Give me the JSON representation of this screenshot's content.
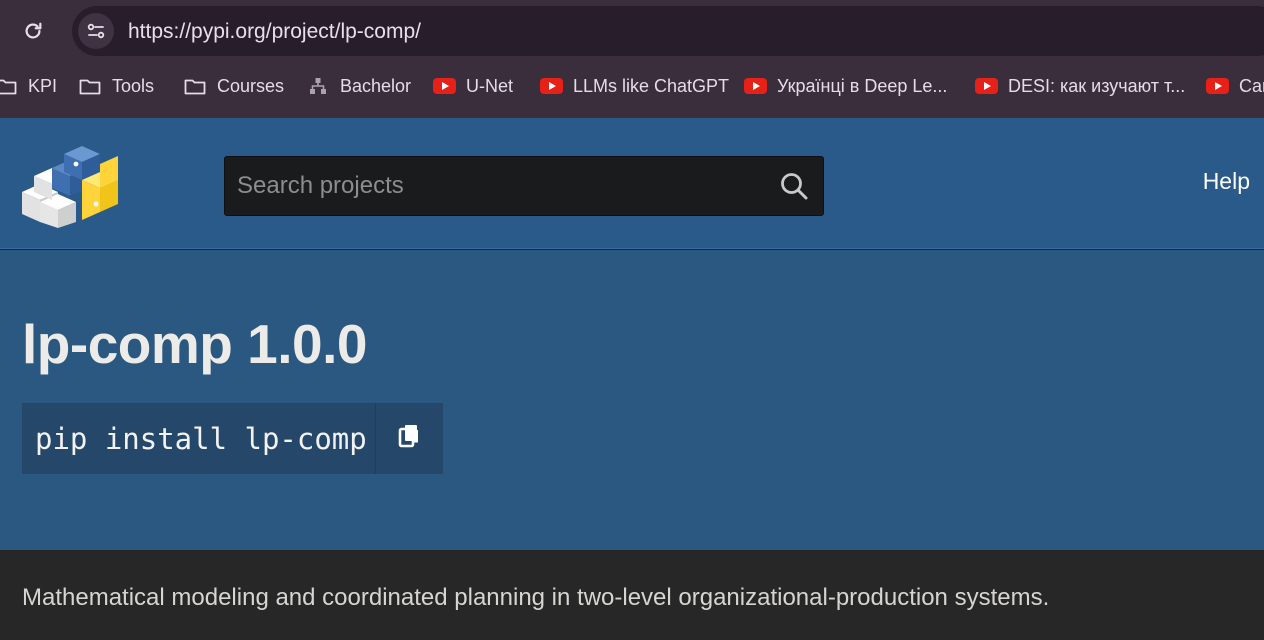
{
  "browser": {
    "url": "https://pypi.org/project/lp-comp/",
    "url_host": "https://pypi.org",
    "url_path": "/project/lp-comp/",
    "reload_icon": "reload-icon",
    "site_info_icon": "tune-icon",
    "bookmarks": [
      {
        "label": "KPI",
        "icon": "folder-icon"
      },
      {
        "label": "Tools",
        "icon": "folder-icon"
      },
      {
        "label": "Courses",
        "icon": "folder-icon"
      },
      {
        "label": "Bachelor",
        "icon": "hierarchy-icon"
      },
      {
        "label": "U-Net",
        "icon": "youtube-icon"
      },
      {
        "label": "LLMs like ChatGPT",
        "icon": "youtube-icon"
      },
      {
        "label": "Українці в Deep Le...",
        "icon": "youtube-icon"
      },
      {
        "label": "DESI: как изучают т...",
        "icon": "youtube-icon"
      },
      {
        "label": "Car",
        "icon": "youtube-icon"
      }
    ]
  },
  "header": {
    "logo": "pypi-logo",
    "search_placeholder": "Search projects",
    "search_icon": "search-icon",
    "help_label": "Help"
  },
  "project": {
    "title": "lp-comp 1.0.0",
    "pip_command": "pip install lp-comp",
    "copy_icon": "copy-icon",
    "description": "Mathematical modeling and coordinated planning in two-level organizational-production systems."
  },
  "colors": {
    "header_bg": "#2a5a89",
    "banner_bg": "#2a5881",
    "pip_bg": "#25476a",
    "chrome_bg": "#3a2e3d",
    "youtube_red": "#e62117"
  }
}
